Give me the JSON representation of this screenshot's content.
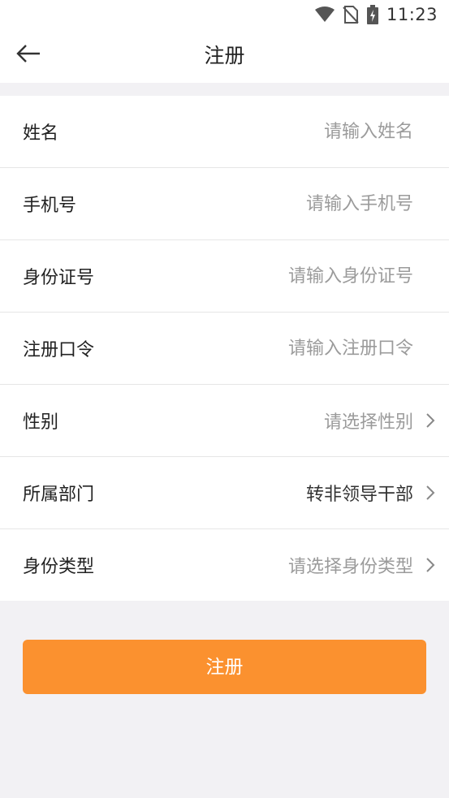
{
  "status_bar": {
    "time": "11:23",
    "icons": [
      "wifi-icon",
      "no-sim-icon",
      "battery-charging-icon"
    ]
  },
  "header": {
    "back_icon": "arrow-left-icon",
    "title": "注册"
  },
  "form": {
    "fields": [
      {
        "label": "姓名",
        "placeholder": "请输入姓名",
        "value": "",
        "type": "input"
      },
      {
        "label": "手机号",
        "placeholder": "请输入手机号",
        "value": "",
        "type": "input"
      },
      {
        "label": "身份证号",
        "placeholder": "请输入身份证号",
        "value": "",
        "type": "input"
      },
      {
        "label": "注册口令",
        "placeholder": "请输入注册口令",
        "value": "",
        "type": "input"
      },
      {
        "label": "性别",
        "display": "请选择性别",
        "type": "select"
      },
      {
        "label": "所属部门",
        "display": "转非领导干部",
        "type": "select"
      },
      {
        "label": "身份类型",
        "display": "请选择身份类型",
        "type": "select"
      }
    ]
  },
  "submit_label": "注册",
  "colors": {
    "accent": "#fb912f",
    "background": "#f2f1f4",
    "placeholder": "#9b9b9b"
  }
}
